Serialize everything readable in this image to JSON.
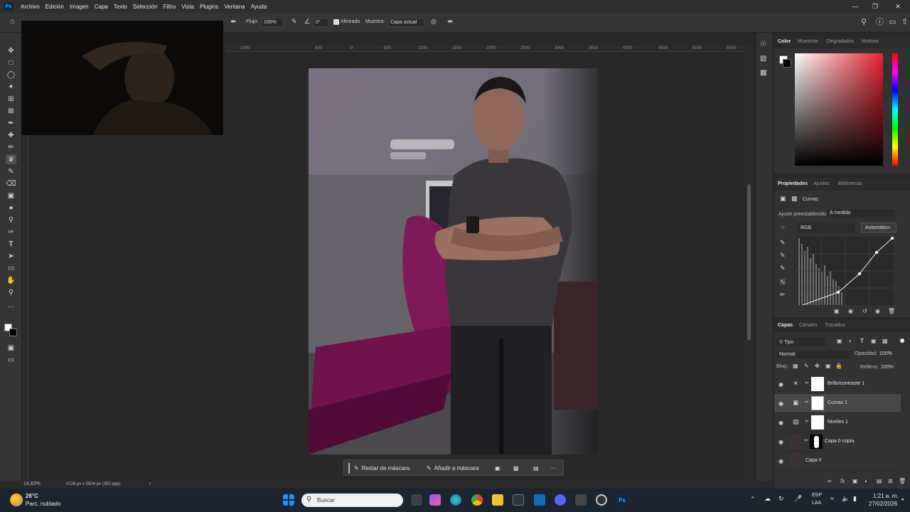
{
  "menubar": {
    "logo": "Ps",
    "items": [
      "Archivo",
      "Edición",
      "Imagen",
      "Capa",
      "Texto",
      "Selección",
      "Filtro",
      "Vista",
      "Plugins",
      "Ventana",
      "Ayuda"
    ]
  },
  "options": {
    "flujo_label": "Flujo:",
    "flujo_value": "100%",
    "angle_value": "0°",
    "alineado_label": "Alineado",
    "muestra_label": "Muestra:",
    "muestra_value": "Capa actual"
  },
  "ruler": {
    "ticks": [
      "1000",
      "500",
      "0",
      "500",
      "1000",
      "1500",
      "2000",
      "2500",
      "3000",
      "3500",
      "4000",
      "4500",
      "5000",
      "5500",
      "6000"
    ]
  },
  "context_bar": {
    "restar": "Restar de máscara",
    "anadir": "Añadir a máscara",
    "more": "···"
  },
  "status": {
    "zoom": "14,83%",
    "doc_info": "4128 px x 5504 px (350 ppp)"
  },
  "color_panel": {
    "tabs": [
      "Color",
      "Muestras",
      "Degradados",
      "Motivos"
    ],
    "active_tab": "Color",
    "hue_color": "#e8232f"
  },
  "properties_panel": {
    "tabs": [
      "Propiedades",
      "Ajustes",
      "Bibliotecas"
    ],
    "active_tab": "Propiedades",
    "title": "Curvas",
    "preset_label": "Ajuste preestablecido:",
    "preset_value": "A medida",
    "channel_value": "RGB",
    "auto_button": "Automático"
  },
  "layers_panel": {
    "tabs": [
      "Capas",
      "Canales",
      "Trazados"
    ],
    "active_tab": "Capas",
    "filter_value": "Tipo",
    "blend_mode": "Normal",
    "opacity_label": "Opacidad:",
    "opacity_value": "100%",
    "lock_label": "Bloq.:",
    "fill_label": "Relleno:",
    "fill_value": "100%",
    "layers": [
      {
        "name": "Brillo/contraste 1",
        "kind": "brightness-icon",
        "selected": false
      },
      {
        "name": "Curvas 1",
        "kind": "curves-icon",
        "selected": true
      },
      {
        "name": "Niveles 1",
        "kind": "levels-icon",
        "selected": false
      },
      {
        "name": "Capa 0 copia",
        "kind": "photo",
        "selected": false
      },
      {
        "name": "Capa 0",
        "kind": "photo",
        "selected": false
      }
    ]
  },
  "taskbar": {
    "weather_temp": "26°C",
    "weather_desc": "Parc. nublado",
    "search_placeholder": "Buscar",
    "lang_top": "ESP",
    "lang_bottom": "LAA",
    "time": "1:21 a. m.",
    "date": "27/02/2026"
  }
}
